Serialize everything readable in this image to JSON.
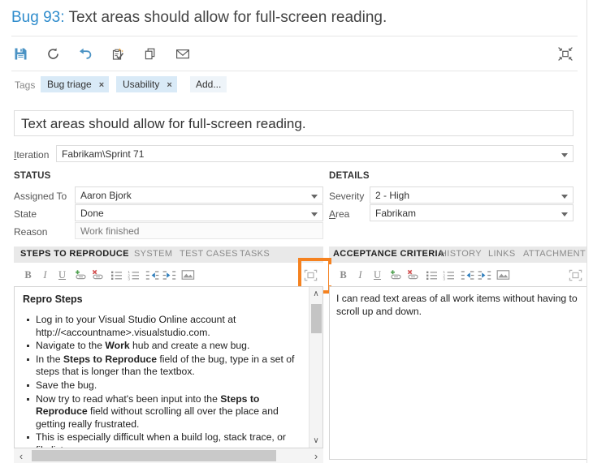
{
  "window": {
    "title_id": "Bug 93:",
    "title_text": "Text areas should allow for full-screen reading."
  },
  "toolbar": {
    "buttons": [
      {
        "name": "save",
        "label": "Save",
        "icon": "save-icon"
      },
      {
        "name": "refresh",
        "label": "Refresh",
        "icon": "refresh-icon"
      },
      {
        "name": "undo",
        "label": "Revert",
        "icon": "undo-icon"
      },
      {
        "name": "revise",
        "label": "Revise",
        "icon": "revise-icon"
      },
      {
        "name": "copy",
        "label": "Copy",
        "icon": "copy-icon"
      },
      {
        "name": "email",
        "label": "Send email",
        "icon": "email-icon"
      }
    ],
    "restore_label": "Restore down",
    "restore_icon": "collapse-icon"
  },
  "tags": {
    "label": "Tags",
    "items": [
      {
        "text": "Bug triage",
        "remove": "×"
      },
      {
        "text": "Usability",
        "remove": "×"
      }
    ],
    "add_label": "Add..."
  },
  "title_field": {
    "value": "Text areas should allow for full-screen reading."
  },
  "iteration": {
    "label": "Iteration",
    "value": "Fabrikam\\Sprint 71"
  },
  "status": {
    "heading": "STATUS",
    "fields": [
      {
        "label": "Assigned To",
        "value": "Aaron Bjork",
        "type": "dropdown",
        "readonly": false
      },
      {
        "label": "State",
        "value": "Done",
        "type": "dropdown",
        "readonly": false
      },
      {
        "label": "Reason",
        "value": "Work finished",
        "type": "text",
        "readonly": true
      }
    ]
  },
  "details": {
    "heading": "DETAILS",
    "fields": [
      {
        "label": "Severity",
        "value": "2 - High",
        "type": "dropdown",
        "readonly": false
      },
      {
        "label": "Area",
        "value": "Fabrikam",
        "type": "dropdown",
        "readonly": false
      }
    ]
  },
  "left_panel": {
    "tabs": [
      {
        "label": "STEPS TO REPRODUCE",
        "active": true
      },
      {
        "label": "SYSTEM",
        "active": false
      },
      {
        "label": "TEST CASES",
        "active": false
      },
      {
        "label": "TASKS",
        "active": false
      }
    ],
    "editor_buttons": [
      {
        "name": "bold",
        "label": "B",
        "icon": "bold-icon"
      },
      {
        "name": "italic",
        "label": "I",
        "icon": "italic-icon"
      },
      {
        "name": "underline",
        "label": "U",
        "icon": "underline-icon"
      },
      {
        "name": "insert-link",
        "label": "",
        "icon": "insert-link-icon"
      },
      {
        "name": "remove-link",
        "label": "",
        "icon": "remove-link-icon"
      },
      {
        "name": "bullet-list",
        "label": "",
        "icon": "bullet-list-icon"
      },
      {
        "name": "numbered-list",
        "label": "",
        "icon": "numbered-list-icon"
      },
      {
        "name": "outdent",
        "label": "",
        "icon": "outdent-icon"
      },
      {
        "name": "indent",
        "label": "",
        "icon": "indent-icon"
      },
      {
        "name": "insert-image",
        "label": "",
        "icon": "insert-image-icon"
      }
    ],
    "maximize_label": "Maximize",
    "maximize_icon": "maximize-icon",
    "content_heading": "Repro Steps",
    "content_items": [
      "Log in to your Visual Studio Online account at http://<accountname>.visualstudio.com.",
      "Navigate to the **Work** hub and create a new bug.",
      "In the **Steps to Reproduce** field of the bug, type in a set of steps that is longer than the textbox.",
      "Save the bug.",
      "Now try to read what's been input into the **Steps to Reproduce** field without scrolling all over the place and getting really frustrated.",
      "This is especially difficult when a build log, stack trace, or file list"
    ],
    "scroll": {
      "up": "∧",
      "down": "∨",
      "left": "‹",
      "right": "›"
    }
  },
  "right_panel": {
    "tabs": [
      {
        "label": "ACCEPTANCE CRITERIA",
        "active": true
      },
      {
        "label": "HISTORY",
        "active": false
      },
      {
        "label": "LINKS",
        "active": false
      },
      {
        "label": "ATTACHMENT",
        "active": false
      }
    ],
    "editor_buttons": [
      {
        "name": "bold",
        "label": "B",
        "icon": "bold-icon"
      },
      {
        "name": "italic",
        "label": "I",
        "icon": "italic-icon"
      },
      {
        "name": "underline",
        "label": "U",
        "icon": "underline-icon"
      },
      {
        "name": "insert-link",
        "label": "",
        "icon": "insert-link-icon"
      },
      {
        "name": "remove-link",
        "label": "",
        "icon": "remove-link-icon"
      },
      {
        "name": "bullet-list",
        "label": "",
        "icon": "bullet-list-icon"
      },
      {
        "name": "numbered-list",
        "label": "",
        "icon": "numbered-list-icon"
      },
      {
        "name": "outdent",
        "label": "",
        "icon": "outdent-icon"
      },
      {
        "name": "indent",
        "label": "",
        "icon": "indent-icon"
      },
      {
        "name": "insert-image",
        "label": "",
        "icon": "insert-image-icon"
      }
    ],
    "maximize_label": "Maximize",
    "maximize_icon": "maximize-icon",
    "content_text": "I can read text areas of all work items without having to scroll up and down."
  },
  "highlight": {
    "color": "#f58220",
    "target": "left-panel-maximize-button"
  },
  "colors": {
    "accent_link": "#2f8ccc",
    "tag_bg": "#d9eaf7",
    "tab_strip_bg": "#e9e9e9",
    "highlight_orange": "#f58220"
  }
}
